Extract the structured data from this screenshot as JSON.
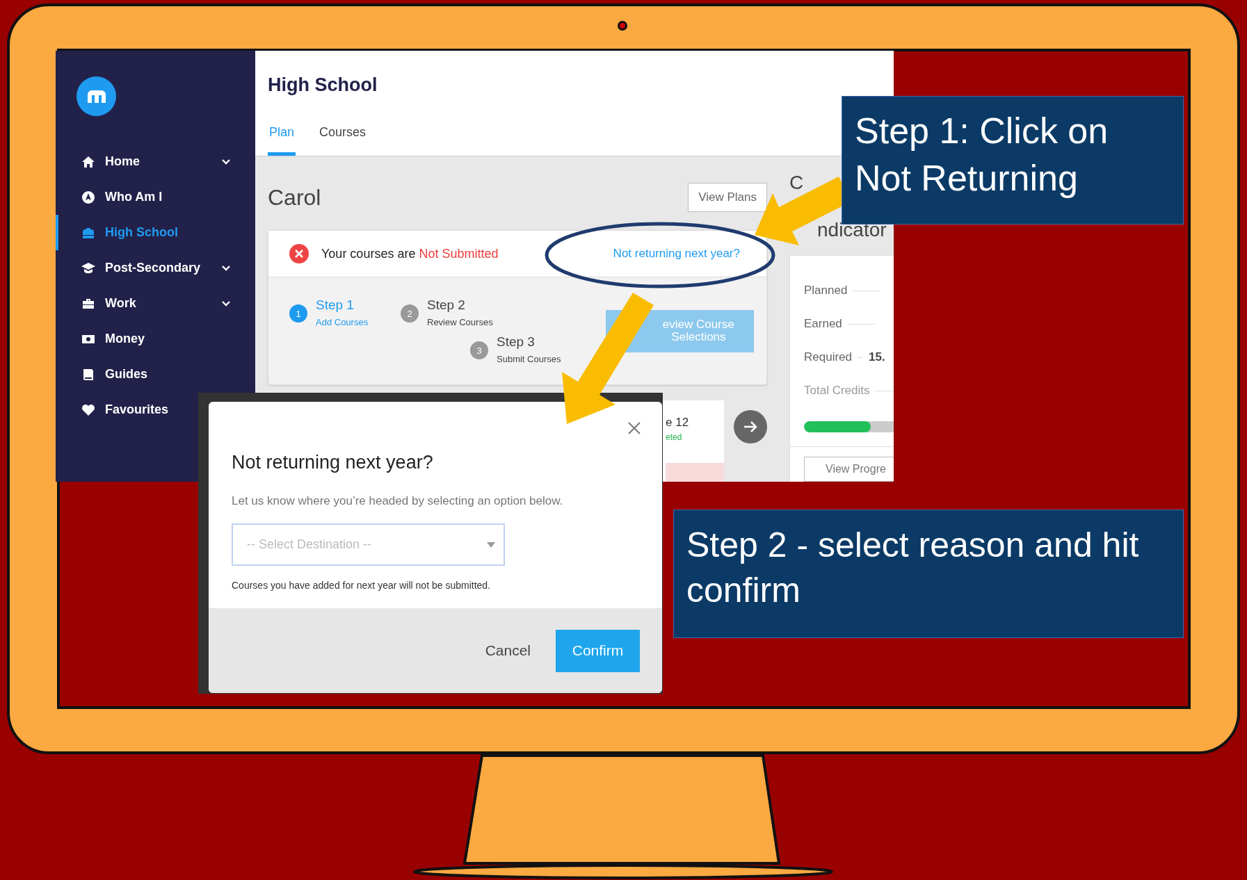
{
  "sidebar": {
    "items": [
      {
        "label": "Home",
        "expandable": true,
        "selected": false
      },
      {
        "label": "Who Am I",
        "expandable": false,
        "selected": false
      },
      {
        "label": "High School",
        "expandable": false,
        "selected": true
      },
      {
        "label": "Post-Secondary",
        "expandable": true,
        "selected": false
      },
      {
        "label": "Work",
        "expandable": true,
        "selected": false
      },
      {
        "label": "Money",
        "expandable": false,
        "selected": false
      },
      {
        "label": "Guides",
        "expandable": false,
        "selected": false
      },
      {
        "label": "Favourites",
        "selected": false
      }
    ]
  },
  "header": {
    "title": "High School",
    "tabs": [
      {
        "label": "Plan",
        "selected": true
      },
      {
        "label": "Courses",
        "selected": false
      }
    ]
  },
  "plan": {
    "student_name": "Carol",
    "view_plans_button": "View Plans",
    "status_prefix": "Your courses are",
    "status": "Not Submitted",
    "not_returning_link": "Not returning next year?",
    "steps": [
      {
        "number": "1",
        "title": "Step 1",
        "subtitle": "Add Courses",
        "selected": true
      },
      {
        "number": "2",
        "title": "Step 2",
        "subtitle": "Review Courses",
        "selected": false
      },
      {
        "number": "3",
        "title": "Step 3",
        "subtitle": "Submit Courses",
        "selected": false
      }
    ],
    "review_button": {
      "label": "eview Course Selections",
      "disabled": true
    },
    "course_card": {
      "title": "e 12",
      "status": "eted"
    }
  },
  "indicator": {
    "heading_start": "C",
    "heading": "ndicator",
    "rows": [
      {
        "label": "Planned"
      },
      {
        "label": "Earned"
      },
      {
        "label": "Required",
        "value": "15."
      },
      {
        "label": "Total Credits"
      }
    ],
    "progress": {
      "level": 0.6
    },
    "button": "View Progre"
  },
  "dialog": {
    "title": "Not returning next year?",
    "description": "Let us know where you’re headed by selecting an option below.",
    "select": {
      "placeholder": "-- Select Destination --"
    },
    "note": "Courses you have added for next year will not be submitted.",
    "buttons": {
      "cancel": "Cancel",
      "confirm": "Confirm"
    }
  },
  "callouts": [
    "Step 1: Click on Not Returning",
    "Step 2 - select reason and hit confirm"
  ]
}
